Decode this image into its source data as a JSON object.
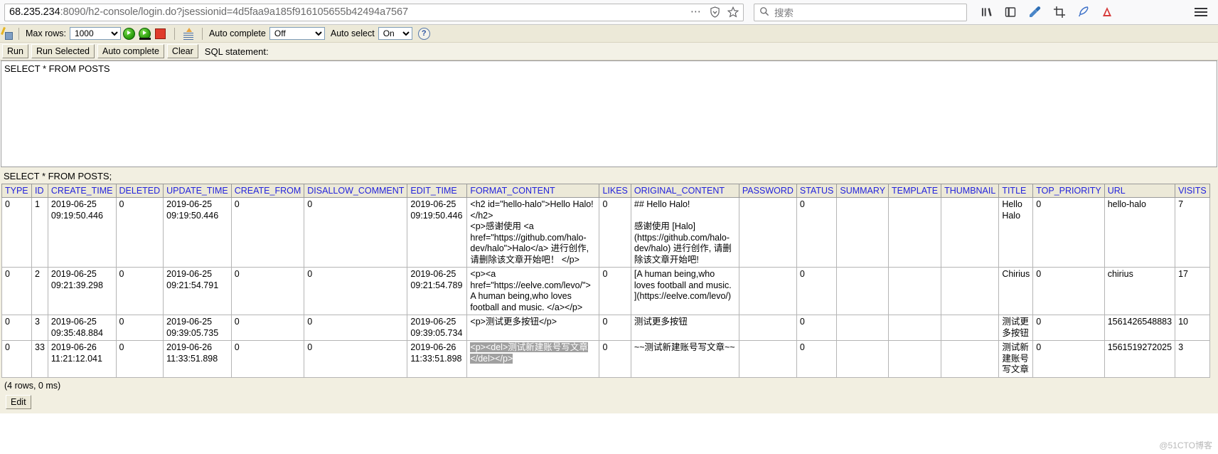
{
  "browser": {
    "url_host": "68.235.234",
    "url_rest": ":8090/h2-console/login.do?jsessionid=4d5faa9a185f916105655b42494a7567",
    "search_placeholder": "搜索",
    "icons": {
      "dots": "⋯",
      "shield": "shield-icon",
      "star": "☆",
      "search": "⚲",
      "library": "library-icon",
      "sidebar": "sidebar-icon",
      "eyedropper": "eyedropper-icon",
      "screenshot": "screenshot-icon",
      "feather": "feather-icon",
      "pocket": "pocket-icon",
      "menu": "☰"
    }
  },
  "toolbar": {
    "max_rows_label": "Max rows:",
    "max_rows_value": "1000",
    "max_rows_options": [
      "1000"
    ],
    "auto_complete_label": "Auto complete",
    "auto_complete_value": "Off",
    "auto_complete_options": [
      "Off"
    ],
    "auto_select_label": "Auto select",
    "auto_select_value": "On",
    "auto_select_options": [
      "On"
    ],
    "help_glyph": "?",
    "run_title": "Run",
    "run_selected_title": "Run Selected",
    "stop_title": "Stop",
    "auto_complete_title": "Auto complete"
  },
  "buttons": {
    "run": "Run",
    "run_selected": "Run Selected",
    "auto_complete": "Auto complete",
    "clear": "Clear",
    "sql_statement_label": "SQL statement:",
    "edit": "Edit"
  },
  "editor": {
    "sql": "SELECT * FROM POSTS"
  },
  "result": {
    "executed_sql": "SELECT * FROM POSTS;",
    "rows_info": "(4 rows, 0 ms)",
    "columns": [
      "TYPE",
      "ID",
      "CREATE_TIME",
      "DELETED",
      "UPDATE_TIME",
      "CREATE_FROM",
      "DISALLOW_COMMENT",
      "EDIT_TIME",
      "FORMAT_CONTENT",
      "LIKES",
      "ORIGINAL_CONTENT",
      "PASSWORD",
      "STATUS",
      "SUMMARY",
      "TEMPLATE",
      "THUMBNAIL",
      "TITLE",
      "TOP_PRIORITY",
      "URL",
      "VISITS"
    ],
    "rows": [
      {
        "TYPE": "0",
        "ID": "1",
        "CREATE_TIME": "2019-06-25 09:19:50.446",
        "DELETED": "0",
        "UPDATE_TIME": "2019-06-25 09:19:50.446",
        "CREATE_FROM": "0",
        "DISALLOW_COMMENT": "0",
        "EDIT_TIME": "2019-06-25 09:19:50.446",
        "FORMAT_CONTENT": "<h2 id=\"hello-halo\">Hello Halo!</h2>\n<p>感谢使用 <a href=\"https://github.com/halo-dev/halo\">Halo</a> 进行创作, 请删除该文章开始吧！ </p>",
        "LIKES": "0",
        "ORIGINAL_CONTENT": "## Hello Halo!\n\n感谢使用 [Halo](https://github.com/halo-dev/halo) 进行创作, 请删除该文章开始吧!",
        "PASSWORD": "",
        "STATUS": "0",
        "SUMMARY": "",
        "TEMPLATE": "",
        "THUMBNAIL": "",
        "TITLE": "Hello Halo",
        "TOP_PRIORITY": "0",
        "URL": "hello-halo",
        "VISITS": "7"
      },
      {
        "TYPE": "0",
        "ID": "2",
        "CREATE_TIME": "2019-06-25 09:21:39.298",
        "DELETED": "0",
        "UPDATE_TIME": "2019-06-25 09:21:54.791",
        "CREATE_FROM": "0",
        "DISALLOW_COMMENT": "0",
        "EDIT_TIME": "2019-06-25 09:21:54.789",
        "FORMAT_CONTENT": "<p><a href=\"https://eelve.com/levo/\">A human being,who loves football and music. </a></p>",
        "LIKES": "0",
        "ORIGINAL_CONTENT": "[A human being,who loves football and music. ](https://eelve.com/levo/)",
        "PASSWORD": "",
        "STATUS": "0",
        "SUMMARY": "",
        "TEMPLATE": "",
        "THUMBNAIL": "",
        "TITLE": "Chirius",
        "TOP_PRIORITY": "0",
        "URL": "chirius",
        "VISITS": "17"
      },
      {
        "TYPE": "0",
        "ID": "3",
        "CREATE_TIME": "2019-06-25 09:35:48.884",
        "DELETED": "0",
        "UPDATE_TIME": "2019-06-25 09:39:05.735",
        "CREATE_FROM": "0",
        "DISALLOW_COMMENT": "0",
        "EDIT_TIME": "2019-06-25 09:39:05.734",
        "FORMAT_CONTENT": "<p>测试更多按钮</p>",
        "LIKES": "0",
        "ORIGINAL_CONTENT": "测试更多按钮",
        "PASSWORD": "",
        "STATUS": "0",
        "SUMMARY": "",
        "TEMPLATE": "",
        "THUMBNAIL": "",
        "TITLE": "测试更多按钮",
        "TOP_PRIORITY": "0",
        "URL": "1561426548883",
        "VISITS": "10"
      },
      {
        "TYPE": "0",
        "ID": "33",
        "CREATE_TIME": "2019-06-26 11:21:12.041",
        "DELETED": "0",
        "UPDATE_TIME": "2019-06-26 11:33:51.898",
        "CREATE_FROM": "0",
        "DISALLOW_COMMENT": "0",
        "EDIT_TIME": "2019-06-26 11:33:51.898",
        "FORMAT_CONTENT": "<p><del>测试新建账号写文章</del></p>",
        "FORMAT_CONTENT_SELECTED": true,
        "LIKES": "0",
        "ORIGINAL_CONTENT": "~~测试新建账号写文章~~",
        "PASSWORD": "",
        "STATUS": "0",
        "SUMMARY": "",
        "TEMPLATE": "",
        "THUMBNAIL": "",
        "TITLE": "测试新建账号写文章",
        "TOP_PRIORITY": "0",
        "URL": "1561519272025",
        "VISITS": "3"
      }
    ]
  },
  "watermark": "@51CTO博客",
  "colors": {
    "header_text": "#2323dc",
    "toolbar_bg": "#ece9d8",
    "result_bg": "#f2efe1",
    "selection_bg": "#a0a0a0"
  }
}
